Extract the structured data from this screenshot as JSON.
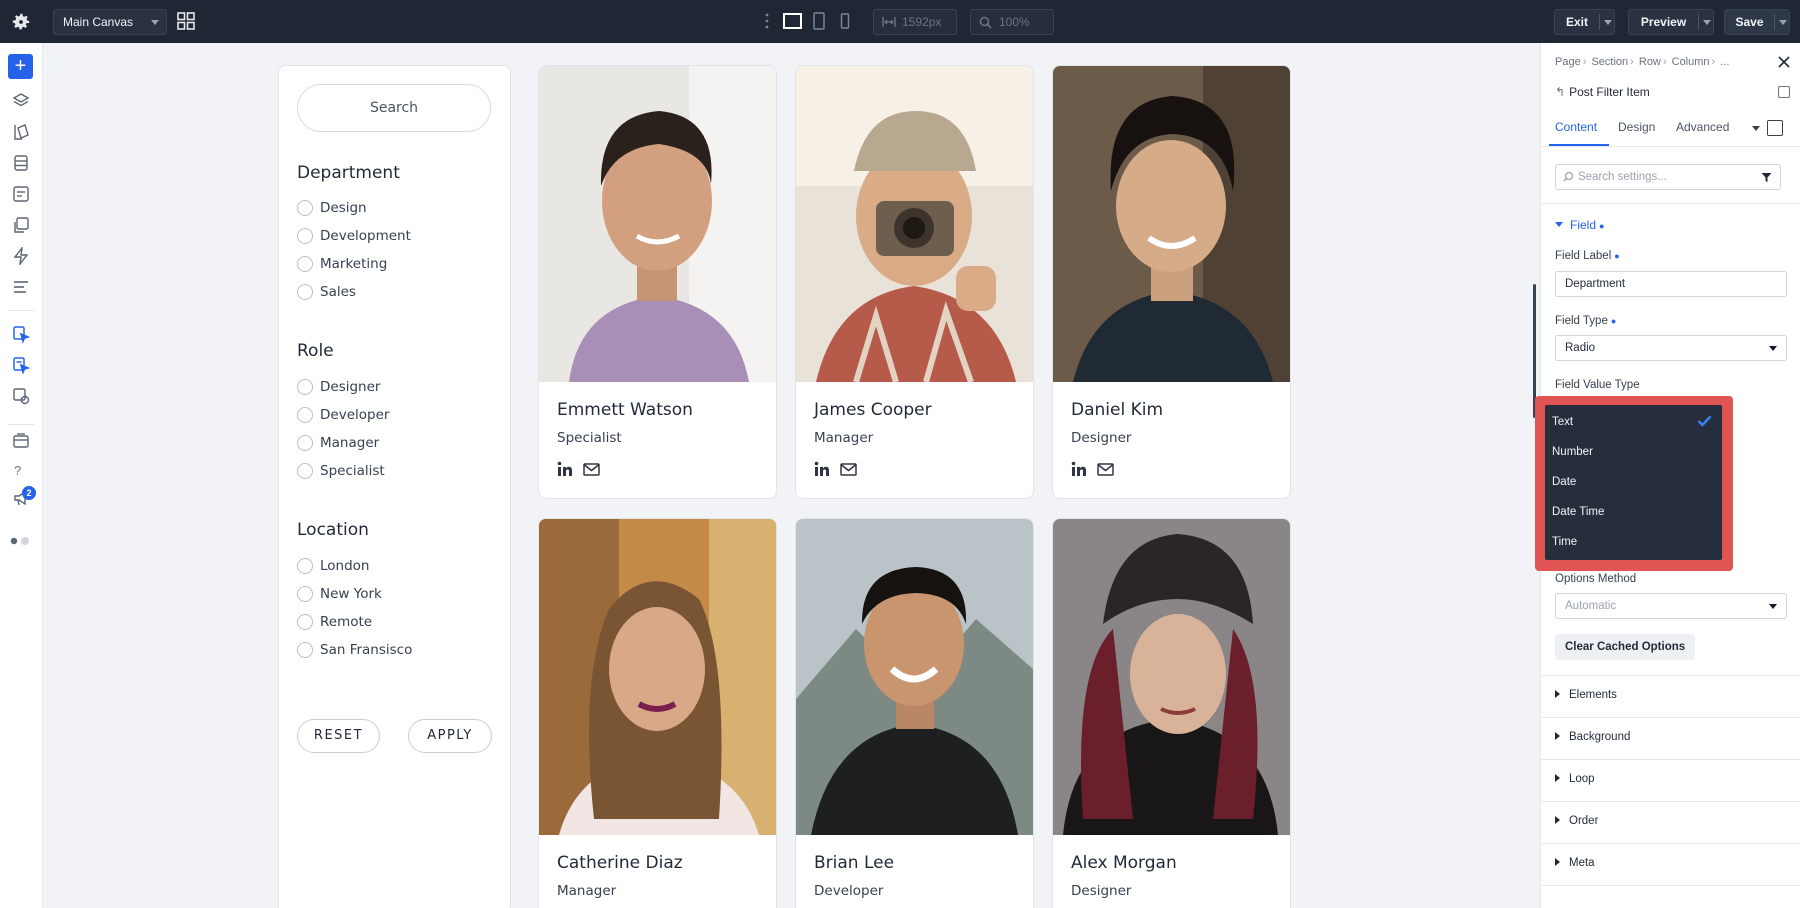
{
  "topbar": {
    "canvas_name": "Main Canvas",
    "width_value": "1592px",
    "zoom_value": "100%",
    "exit_label": "Exit",
    "preview_label": "Preview",
    "save_label": "Save"
  },
  "rail": {
    "add_label": "+",
    "help_label": "?",
    "notification_count": "2"
  },
  "filter": {
    "search_label": "Search",
    "groups": [
      {
        "title": "Department",
        "options": [
          "Design",
          "Development",
          "Marketing",
          "Sales"
        ]
      },
      {
        "title": "Role",
        "options": [
          "Designer",
          "Developer",
          "Manager",
          "Specialist"
        ]
      },
      {
        "title": "Location",
        "options": [
          "London",
          "New York",
          "Remote",
          "San Fransisco"
        ]
      }
    ],
    "reset_label": "RESET",
    "apply_label": "APPLY"
  },
  "people": [
    {
      "name": "Emmett Watson",
      "role": "Specialist"
    },
    {
      "name": "James Cooper",
      "role": "Manager"
    },
    {
      "name": "Daniel Kim",
      "role": "Designer"
    },
    {
      "name": "Catherine Diaz",
      "role": "Manager"
    },
    {
      "name": "Brian Lee",
      "role": "Developer"
    },
    {
      "name": "Alex Morgan",
      "role": "Designer"
    }
  ],
  "panel": {
    "breadcrumb": [
      "Page",
      "Section",
      "Row",
      "Column",
      "..."
    ],
    "module_title": "Post Filter Item",
    "tabs": [
      "Content",
      "Design",
      "Advanced"
    ],
    "active_tab": "Content",
    "search_placeholder": "Search settings...",
    "field_section": "Field",
    "field_label_label": "Field Label",
    "field_label_value": "Department",
    "field_type_label": "Field Type",
    "field_type_value": "Radio",
    "field_value_type_label": "Field Value Type",
    "options_method_label": "Options Method",
    "options_method_value": "Automatic",
    "clear_button": "Clear Cached Options",
    "collapsed_sections": [
      "Elements",
      "Background",
      "Loop",
      "Order",
      "Meta"
    ]
  },
  "dropdown": {
    "options": [
      "Text",
      "Number",
      "Date",
      "Date Time",
      "Time"
    ],
    "selected": "Text"
  },
  "colors": {
    "accent": "#2563eb",
    "topbar_bg": "#1f2634",
    "dropdown_bg": "#262e3d",
    "highlight_frame": "#e15454"
  }
}
